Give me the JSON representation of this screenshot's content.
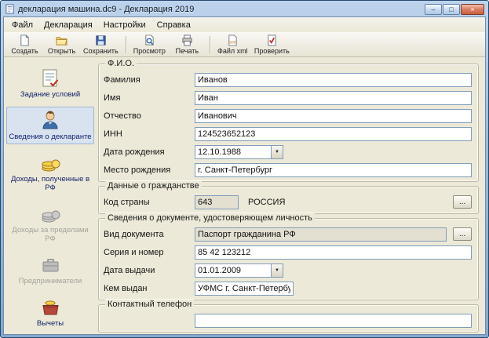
{
  "window": {
    "title": "декларация машина.dc9 - Декларация 2019",
    "controls": {
      "minimize": "–",
      "maximize": "□",
      "close": "×"
    }
  },
  "icons": {
    "dropdown": "▼"
  },
  "menu": {
    "items": [
      {
        "label": "Файл"
      },
      {
        "label": "Декларация"
      },
      {
        "label": "Настройки"
      },
      {
        "label": "Справка"
      }
    ]
  },
  "toolbar": {
    "buttons": [
      {
        "label": "Создать",
        "icon": "new-document-icon"
      },
      {
        "label": "Открыть",
        "icon": "open-folder-icon"
      },
      {
        "label": "Сохранить",
        "icon": "save-icon"
      },
      {
        "label": "Просмотр",
        "icon": "preview-icon"
      },
      {
        "label": "Печать",
        "icon": "print-icon"
      },
      {
        "label": "Файл xml",
        "icon": "xml-file-icon"
      },
      {
        "label": "Проверить",
        "icon": "check-icon"
      }
    ]
  },
  "sidebar": {
    "items": [
      {
        "label": "Задание условий",
        "icon": "conditions-icon",
        "state": "normal"
      },
      {
        "label": "Сведения о декларанте",
        "icon": "declarant-icon",
        "state": "selected"
      },
      {
        "label": "Доходы, полученные в РФ",
        "icon": "incomes-rf-icon",
        "state": "normal"
      },
      {
        "label": "Доходы за пределами РФ",
        "icon": "incomes-abroad-icon",
        "state": "disabled"
      },
      {
        "label": "Предприниматели",
        "icon": "entrepreneurs-icon",
        "state": "disabled"
      },
      {
        "label": "Вычеты",
        "icon": "deductions-icon",
        "state": "normal"
      }
    ]
  },
  "form": {
    "fio": {
      "title": "Ф.И.О.",
      "rows": [
        {
          "label": "Фамилия",
          "value": "Иванов"
        },
        {
          "label": "Имя",
          "value": "Иван"
        },
        {
          "label": "Отчество",
          "value": "Иванович"
        },
        {
          "label": "ИНН",
          "value": "124523652123"
        },
        {
          "label": "Дата рождения",
          "value": "12.10.1988"
        },
        {
          "label": "Место рождения",
          "value": "г. Санкт-Петербург"
        }
      ]
    },
    "citizenship": {
      "title": "Данные о гражданстве",
      "code_label": "Код страны",
      "code_value": "643",
      "country_name": "РОССИЯ",
      "browse_label": "..."
    },
    "document": {
      "title": "Сведения о документе, удостоверяющем личность",
      "browse_label": "...",
      "rows": [
        {
          "label": "Вид документа",
          "value": "Паспорт гражданина РФ"
        },
        {
          "label": "Серия и номер",
          "value": "85 42 123212"
        },
        {
          "label": "Дата выдачи",
          "value": "01.01.2009"
        },
        {
          "label": "Кем выдан",
          "value": "УФМС г. Санкт-Петербург"
        }
      ]
    },
    "phone": {
      "title": "Контактный телефон",
      "value": ""
    }
  }
}
